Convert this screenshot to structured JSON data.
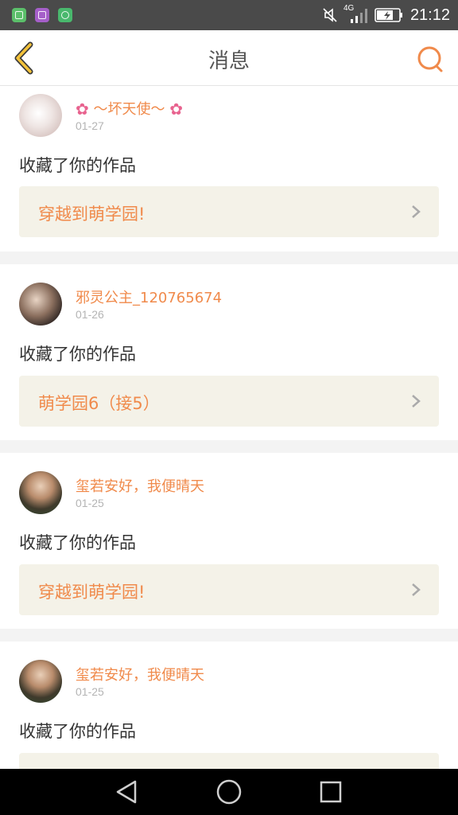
{
  "status_bar": {
    "time": "21:12",
    "network": "4G",
    "icons": [
      "app-icon-green",
      "app-icon-purple",
      "app-icon-green-round",
      "mute-icon",
      "signal-icon",
      "battery-icon"
    ]
  },
  "header": {
    "title": "消息",
    "back_icon": "chevron-left-icon",
    "search_icon": "search-icon"
  },
  "messages": [
    {
      "user": "～坏天使～",
      "decorated": true,
      "date": "01-27",
      "action": "收藏了你的作品",
      "work": "穿越到萌学园!"
    },
    {
      "user": "邪灵公主_120765674",
      "decorated": false,
      "date": "01-26",
      "action": "收藏了你的作品",
      "work": "萌学园6（接5）"
    },
    {
      "user": "玺若安好，我便晴天",
      "decorated": false,
      "date": "01-25",
      "action": "收藏了你的作品",
      "work": "穿越到萌学园!"
    },
    {
      "user": "玺若安好，我便晴天",
      "decorated": false,
      "date": "01-25",
      "action": "收藏了你的作品",
      "work": ""
    }
  ],
  "colors": {
    "accent": "#f08a4b",
    "status_bar": "#4a4a4a",
    "card_link_bg": "#f4f2e8",
    "separator": "#f3f3f3"
  }
}
